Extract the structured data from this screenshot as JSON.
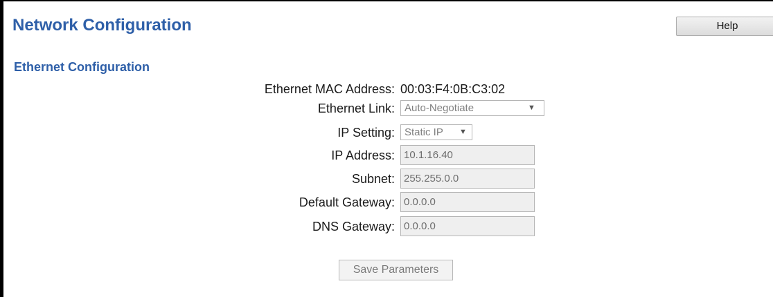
{
  "page": {
    "title": "Network Configuration",
    "help_label": "Help"
  },
  "ethernet": {
    "section_title": "Ethernet Configuration",
    "fields": {
      "mac": {
        "label": "Ethernet MAC Address:",
        "value": "00:03:F4:0B:C3:02"
      },
      "link": {
        "label": "Ethernet Link:",
        "value": "Auto-Negotiate"
      },
      "ip_setting": {
        "label": "IP Setting:",
        "value": "Static IP"
      },
      "ip_address": {
        "label": "IP Address:",
        "value": "10.1.16.40"
      },
      "subnet": {
        "label": "Subnet:",
        "value": "255.255.0.0"
      },
      "default_gateway": {
        "label": "Default Gateway:",
        "value": "0.0.0.0"
      },
      "dns_gateway": {
        "label": "DNS Gateway:",
        "value": "0.0.0.0"
      }
    },
    "save_label": "Save Parameters"
  },
  "icons": {
    "dropdown_arrow": "▼"
  },
  "colors": {
    "title": "#2e5fa8",
    "disabled_text": "#808080",
    "field_bg": "#efefef"
  }
}
